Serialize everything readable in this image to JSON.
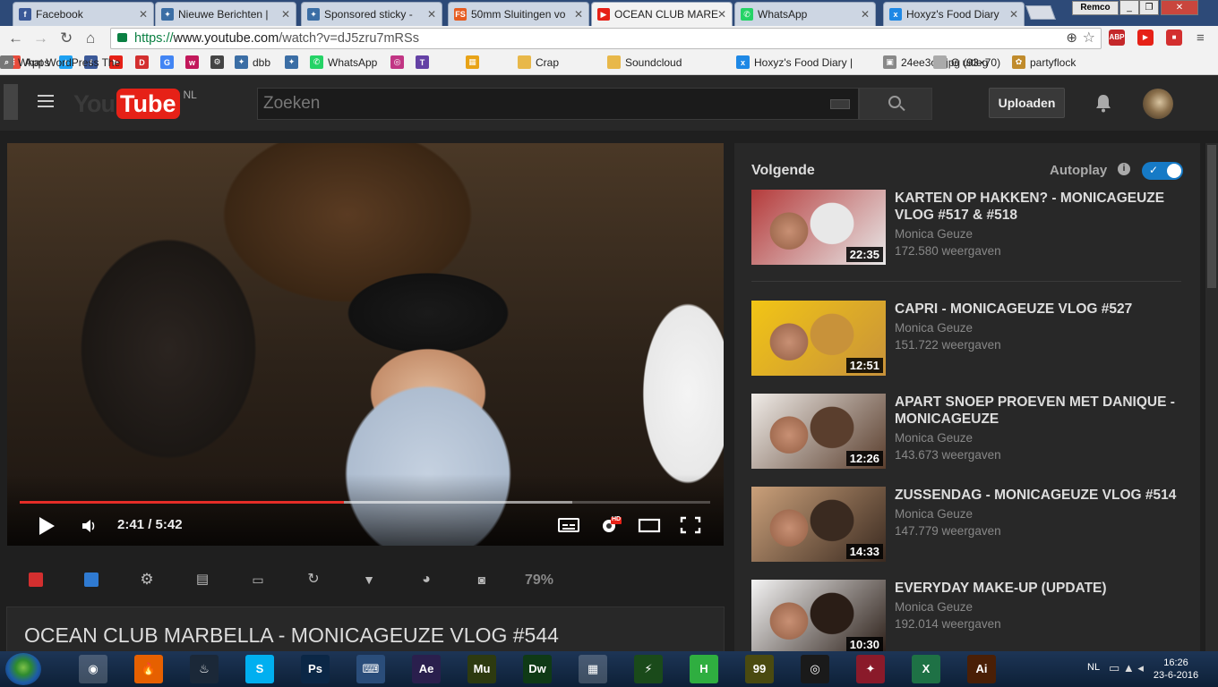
{
  "browser": {
    "tabs": [
      {
        "title": "Facebook",
        "icon": "facebook-icon",
        "color": "#3b5998",
        "letter": "f"
      },
      {
        "title": "Nieuwe Berichten |",
        "icon": "board-icon",
        "color": "#3b6ea5",
        "letter": "✦"
      },
      {
        "title": "Sponsored sticky -",
        "icon": "board-icon",
        "color": "#3b6ea5",
        "letter": "✦"
      },
      {
        "title": "50mm Sluitingen vo",
        "icon": "fs-icon",
        "color": "#e65c20",
        "letter": "FS"
      },
      {
        "title": "OCEAN CLUB MARE",
        "icon": "youtube-icon",
        "color": "#e62117",
        "letter": "▶"
      },
      {
        "title": "WhatsApp",
        "icon": "whatsapp-icon",
        "color": "#25d366",
        "letter": "✆"
      },
      {
        "title": "Hoxyz's Food Diary",
        "icon": "hoxyz-icon",
        "color": "#1e88e5",
        "letter": "x"
      }
    ],
    "profile_name": "Remco",
    "url_protocol": "https://",
    "url_host": "www.youtube.com",
    "url_path": "/watch?v=dJ5zru7mRSs",
    "extensions": [
      {
        "name": "abp-icon",
        "label": "ABP",
        "color": "#c4282a"
      },
      {
        "name": "youtube-ext-icon",
        "label": "▶",
        "color": "#e62117"
      },
      {
        "name": "red-ext-icon",
        "label": "■",
        "color": "#d32f2f"
      }
    ],
    "bookmarks": [
      {
        "label": "Apps",
        "icon": "apps-icon",
        "color": "#e74c3c",
        "letter": "⋮"
      },
      {
        "label": "",
        "icon": "twitter-icon",
        "color": "#1da1f2",
        "letter": "t"
      },
      {
        "label": "",
        "icon": "facebook-icon",
        "color": "#3b5998",
        "letter": "f"
      },
      {
        "label": "",
        "icon": "youtube-icon",
        "color": "#e62117",
        "letter": "▶"
      },
      {
        "label": "",
        "icon": "red-play-icon",
        "color": "#d32f2f",
        "letter": "D"
      },
      {
        "label": "",
        "icon": "google-icon",
        "color": "#4285f4",
        "letter": "G"
      },
      {
        "label": "",
        "icon": "pink-icon",
        "color": "#c2185b",
        "letter": "w"
      },
      {
        "label": "",
        "icon": "gear-bm-icon",
        "color": "#444",
        "letter": "⚙"
      },
      {
        "label": "dbb",
        "icon": "board-icon",
        "color": "#3b6ea5",
        "letter": "✦"
      },
      {
        "label": "",
        "icon": "board-icon",
        "color": "#3b6ea5",
        "letter": "✦"
      },
      {
        "label": "WhatsApp",
        "icon": "whatsapp-icon",
        "color": "#25d366",
        "letter": "✆"
      },
      {
        "label": "",
        "icon": "instagram-icon",
        "color": "#c13584",
        "letter": "◎"
      },
      {
        "label": "",
        "icon": "twitch-icon",
        "color": "#6441a5",
        "letter": "T"
      },
      {
        "label": "",
        "icon": "multicolor-icon",
        "color": "#e8a317",
        "letter": "▦"
      },
      {
        "label": "Crap",
        "icon": "folder-icon",
        "color": "#e8b84a",
        "letter": ""
      },
      {
        "label": "Soundcloud",
        "icon": "folder-icon",
        "color": "#e8b84a",
        "letter": ""
      },
      {
        "label": "Hoxyz's Food Diary |",
        "icon": "hoxyz-icon",
        "color": "#1e88e5",
        "letter": "x"
      },
      {
        "label": "24ee3oh.jpg (93×70)",
        "icon": "image-icon",
        "color": "#888",
        "letter": "▣"
      },
      {
        "label": "G uitleg",
        "icon": "page-icon",
        "color": "#aaa",
        "letter": ""
      },
      {
        "label": "partyflock",
        "icon": "partyflock-icon",
        "color": "#c08b2c",
        "letter": "✿"
      },
      {
        "label": "What WordPress The",
        "icon": "search-bm-icon",
        "color": "#777",
        "letter": "⌕"
      }
    ]
  },
  "youtube": {
    "logo_you": "You",
    "logo_tube": "Tube",
    "country": "NL",
    "search_placeholder": "Zoeken",
    "upload_label": "Uploaden",
    "player": {
      "current_time": "2:41",
      "duration": "5:42",
      "played_fraction": 0.47,
      "buffered_fraction": 0.8,
      "hd_badge": "HD"
    },
    "ext_zoom": "79%",
    "video_title": "OCEAN CLUB MARBELLA - MONICAGEUZE VLOG #544",
    "up_next_label": "Volgende",
    "autoplay_label": "Autoplay",
    "autoplay_on": true,
    "related": [
      {
        "title": "KARTEN OP HAKKEN? - MONICAGEUZE VLOG #517 & #518",
        "channel": "Monica Geuze",
        "views": "172.580 weergaven",
        "duration": "22:35",
        "c1": "#b53b3b",
        "c2": "#e8e8e8"
      },
      {
        "title": "CAPRI - MONICAGEUZE VLOG #527",
        "channel": "Monica Geuze",
        "views": "151.722 weergaven",
        "duration": "12:51",
        "c1": "#f2c515",
        "c2": "#c8923a"
      },
      {
        "title": "APART SNOEP PROEVEN MET DANIQUE - MONICAGEUZE",
        "channel": "Monica Geuze",
        "views": "143.673 weergaven",
        "duration": "12:26",
        "c1": "#f0ece8",
        "c2": "#5a3e2d"
      },
      {
        "title": "ZUSSENDAG - MONICAGEUZE VLOG #514",
        "channel": "Monica Geuze",
        "views": "147.779 weergaven",
        "duration": "14:33",
        "c1": "#caa07a",
        "c2": "#3a2a20"
      },
      {
        "title": "EVERYDAY MAKE-UP (UPDATE)",
        "channel": "Monica Geuze",
        "views": "192.014 weergaven",
        "duration": "10:30",
        "c1": "#f4f4f4",
        "c2": "#2a1d16"
      }
    ]
  },
  "taskbar": {
    "apps": [
      {
        "name": "chrome-taskbar-icon",
        "label": "◉",
        "color": "#dd4b39",
        "active": true
      },
      {
        "name": "firefox-taskbar-icon",
        "label": "🔥",
        "color": "#e66000",
        "active": false
      },
      {
        "name": "steam-taskbar-icon",
        "label": "♨",
        "color": "#1b2838",
        "active": false
      },
      {
        "name": "skype-taskbar-icon",
        "label": "S",
        "color": "#00aff0",
        "active": false
      },
      {
        "name": "photoshop-taskbar-icon",
        "label": "Ps",
        "color": "#0b2746",
        "active": false
      },
      {
        "name": "keyboard-taskbar-icon",
        "label": "⌨",
        "color": "#2a4d7a",
        "active": false
      },
      {
        "name": "aftereffects-taskbar-icon",
        "label": "Ae",
        "color": "#2a1f4d",
        "active": false
      },
      {
        "name": "muse-taskbar-icon",
        "label": "Mu",
        "color": "#2d3a10",
        "active": false
      },
      {
        "name": "dreamweaver-taskbar-icon",
        "label": "Dw",
        "color": "#0f3a16",
        "active": false
      },
      {
        "name": "film-taskbar-icon",
        "label": "▦",
        "color": "#222",
        "active": true
      },
      {
        "name": "game-taskbar-icon",
        "label": "⚡",
        "color": "#1a4a1a",
        "active": false
      },
      {
        "name": "h-taskbar-icon",
        "label": "H",
        "color": "#2fae40",
        "active": false
      },
      {
        "name": "yellow-taskbar-icon",
        "label": "99",
        "color": "#4a4a10",
        "active": false
      },
      {
        "name": "ring-taskbar-icon",
        "label": "◎",
        "color": "#1a1a1a",
        "active": false
      },
      {
        "name": "bird-taskbar-icon",
        "label": "✦",
        "color": "#8a1a2a",
        "active": false
      },
      {
        "name": "excel-taskbar-icon",
        "label": "X",
        "color": "#1e7145",
        "active": false
      },
      {
        "name": "illustrator-taskbar-icon",
        "label": "Ai",
        "color": "#4a1f06",
        "active": false
      }
    ],
    "lang": "NL",
    "time": "16:26",
    "date": "23-6-2016"
  }
}
